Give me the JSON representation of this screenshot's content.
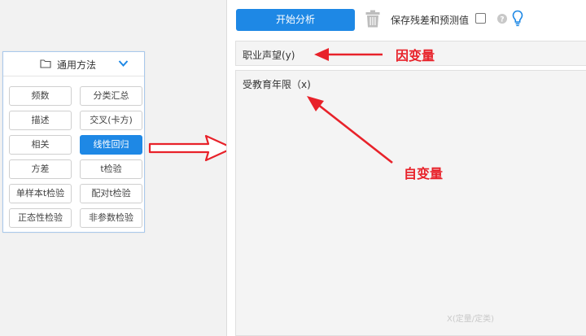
{
  "methods_panel": {
    "title": "通用方法",
    "buttons": [
      {
        "label": "频数",
        "active": false
      },
      {
        "label": "分类汇总",
        "active": false
      },
      {
        "label": "描述",
        "active": false
      },
      {
        "label": "交叉(卡方)",
        "active": false
      },
      {
        "label": "相关",
        "active": false
      },
      {
        "label": "线性回归",
        "active": true
      },
      {
        "label": "方差",
        "active": false
      },
      {
        "label": "t检验",
        "active": false
      },
      {
        "label": "单样本t检验",
        "active": false
      },
      {
        "label": "配对t检验",
        "active": false
      },
      {
        "label": "正态性检验",
        "active": false
      },
      {
        "label": "非参数检验",
        "active": false
      }
    ]
  },
  "toolbar": {
    "start_label": "开始分析",
    "save_residual_label": "保存残差和预测值",
    "save_residual_checked": false
  },
  "dependent_box": {
    "variable": "职业声望(y)"
  },
  "independent_box": {
    "variable": "受教育年限（x)",
    "hint": "X(定量/定类)"
  },
  "annotations": {
    "dependent_label": "因变量",
    "independent_label": "自变量"
  },
  "colors": {
    "accent": "#1e88e5",
    "annotation": "#e8222a"
  },
  "icons": [
    "folder-icon",
    "chevron-down-icon",
    "trash-icon",
    "help-icon",
    "lightbulb-icon",
    "arrow-right-icon"
  ]
}
